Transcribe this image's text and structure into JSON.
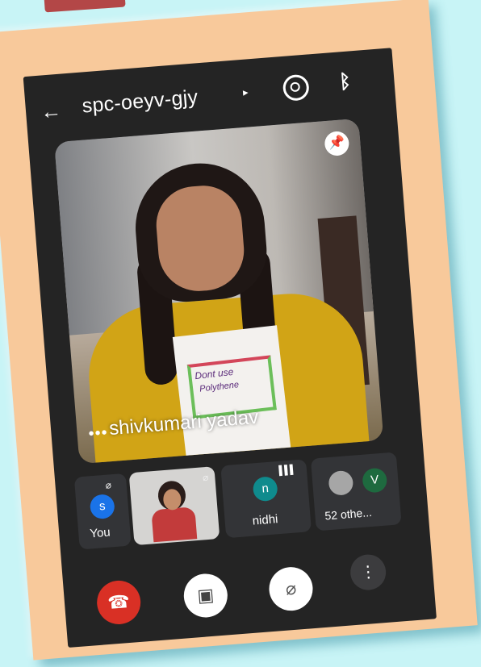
{
  "meeting": {
    "title": "spc-oeyv-gjy",
    "caret": "▸"
  },
  "main_video": {
    "participant_name": "shivkumari yadav",
    "more": "•••",
    "poster_line1": "Dont use",
    "poster_line2": "Polythene"
  },
  "tiles": [
    {
      "avatar": "s",
      "label": "You",
      "mic": "muted",
      "avatar_color": "#1a73e8"
    },
    {
      "avatar": "",
      "label": "",
      "mic": "muted",
      "video": true
    },
    {
      "avatar": "n",
      "label": "nidhi",
      "mic": "speaking",
      "avatar_color": "#0f8b8d"
    },
    {
      "avatar": "V",
      "label": "52 othe...",
      "avatar_color": "#1e6a3f"
    }
  ],
  "controls": {
    "end_call": "end-call",
    "camera": "camera-off",
    "mic": "mic-off",
    "more": "more-options"
  },
  "colors": {
    "background": "#c8f4f6",
    "card": "#f8c99b",
    "phone": "#242424",
    "end_call": "#d93025"
  }
}
